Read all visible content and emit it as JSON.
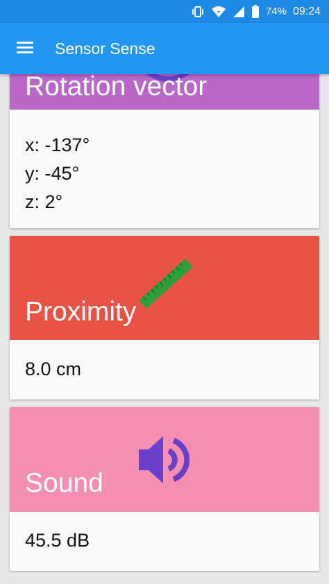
{
  "status_bar": {
    "battery": "74%",
    "time": "09:24",
    "icons": [
      "vibrate-icon",
      "wifi-icon",
      "signal-icon",
      "battery-icon"
    ]
  },
  "app_bar": {
    "title": "Sensor Sense",
    "background": "#2196f3",
    "menu_icon": "hamburger-menu-icon"
  },
  "cards": [
    {
      "title": "Rotation vector",
      "color": "#ba68c8",
      "icon": "rotation-icon",
      "values": [
        "x: -137°",
        "y: -45°",
        "z: 2°"
      ]
    },
    {
      "title": "Proximity",
      "color": "#e85346",
      "icon": "ruler-icon",
      "values": [
        "8.0 cm"
      ]
    },
    {
      "title": "Sound",
      "color": "#f48fb1",
      "icon": "speaker-icon",
      "values": [
        "45.5 dB"
      ]
    }
  ]
}
